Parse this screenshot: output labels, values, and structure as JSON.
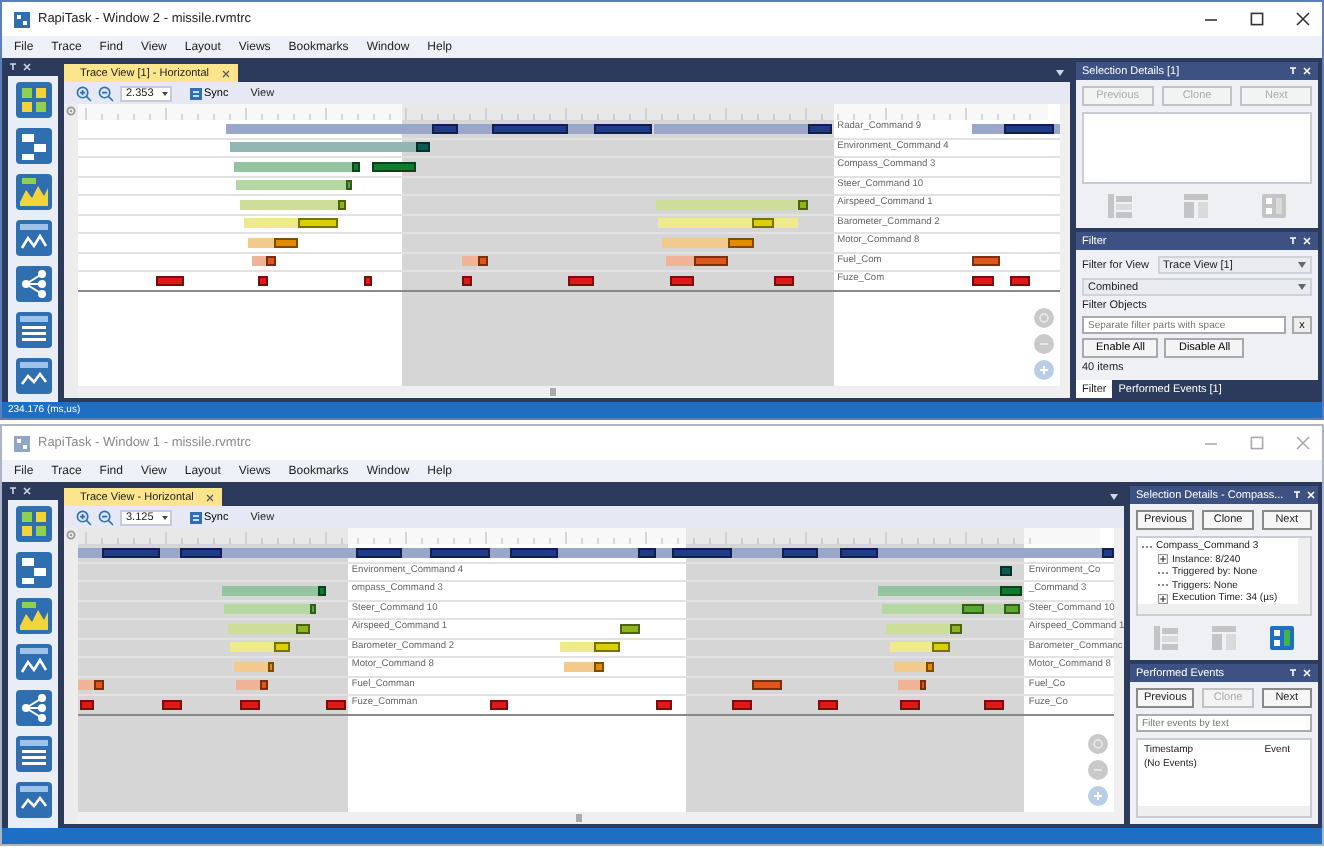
{
  "windows": [
    {
      "active": true,
      "title": "RapiTask - Window 2 - missile.rvmtrc",
      "menu": [
        "File",
        "Trace",
        "Find",
        "View",
        "Layout",
        "Views",
        "Bookmarks",
        "Window",
        "Help"
      ],
      "tab": "Trace View [1] - Horizontal",
      "zoom": "2.353",
      "sync": "Sync",
      "view": "View",
      "rows": [
        {
          "color": "#1f3a8a",
          "labels": [
            "Radar_Command 9"
          ]
        },
        {
          "color": "#0b5a4f",
          "labels": [
            "Environment_Command 4"
          ]
        },
        {
          "color": "#127a2e",
          "labels": [
            "Compass_Command 3"
          ]
        },
        {
          "color": "#5aa832",
          "labels": [
            "Steer_Command 10"
          ]
        },
        {
          "color": "#8fb51e",
          "labels": [
            "Airspeed_Command 1"
          ]
        },
        {
          "color": "#d8d000",
          "labels": [
            "Barometer_Command 2"
          ]
        },
        {
          "color": "#e38b00",
          "labels": [
            "Motor_Command 8"
          ]
        },
        {
          "color": "#e0561a",
          "labels": [
            "Fuel_Com"
          ]
        },
        {
          "color": "#e01818",
          "labels": [
            "Fuze_Com"
          ]
        }
      ],
      "panels": [
        {
          "kind": "details",
          "title": "Selection Details [1]",
          "buttons": [
            {
              "label": "Previous",
              "disabled": true
            },
            {
              "label": "Clone",
              "disabled": true
            },
            {
              "label": "Next",
              "disabled": true
            }
          ],
          "icons": [
            {
              "enabled": false
            },
            {
              "enabled": false
            },
            {
              "enabled": false
            }
          ]
        },
        {
          "kind": "filter",
          "title": "Filter",
          "view_label": "Filter for View",
          "view_value": "Trace View [1]",
          "mode": "Combined",
          "objects_label": "Filter Objects",
          "placeholder": "Separate filter parts with space",
          "clear": "x",
          "buttons": [
            "Enable All",
            "Disable All"
          ],
          "count": "40 items",
          "tabs": [
            {
              "label": "Filter",
              "selected": true
            },
            {
              "label": "Performed Events [1]",
              "selected": false
            }
          ]
        }
      ],
      "status": "234.176 (ms,us)"
    },
    {
      "active": false,
      "title": "RapiTask - Window 1 - missile.rvmtrc",
      "menu": [
        "File",
        "Trace",
        "Find",
        "View",
        "Layout",
        "Views",
        "Bookmarks",
        "Window",
        "Help"
      ],
      "tab": "Trace View - Horizontal",
      "zoom": "3.125",
      "sync": "Sync",
      "view": "View",
      "rows": [
        {
          "color": "#1f3a8a"
        },
        {
          "color": "#0b5a4f",
          "labels": [
            "Environment_Command 4",
            "Environment_Co"
          ]
        },
        {
          "color": "#127a2e",
          "labels": [
            "ompass_Command 3",
            "_Command 3"
          ]
        },
        {
          "color": "#5aa832",
          "labels": [
            "Steer_Command 10",
            "Steer_Command 10"
          ]
        },
        {
          "color": "#8fb51e",
          "labels": [
            "Airspeed_Command 1",
            "Airspeed_Command 1"
          ]
        },
        {
          "color": "#d8d000",
          "labels": [
            "Barometer_Command 2",
            "Barometer_Commanc"
          ]
        },
        {
          "color": "#e38b00",
          "labels": [
            "Motor_Command 8",
            "Motor_Command 8"
          ]
        },
        {
          "color": "#e0561a",
          "labels": [
            "Fuel_Comman",
            "Fuel_Co"
          ]
        },
        {
          "color": "#e01818",
          "labels": [
            "Fuze_Comman",
            "Fuze_Co"
          ]
        }
      ],
      "panels": [
        {
          "kind": "details",
          "title": "Selection Details - Compass...",
          "buttons": [
            {
              "label": "Previous",
              "disabled": false
            },
            {
              "label": "Clone",
              "disabled": false
            },
            {
              "label": "Next",
              "disabled": false
            }
          ],
          "tree": [
            {
              "label": "Compass_Command 3",
              "expandable": false,
              "children": [
                {
                  "label": "Instance: 8/240",
                  "expandable": true
                },
                {
                  "label": "Triggered by: None",
                  "expandable": false
                },
                {
                  "label": "Triggers: None",
                  "expandable": false
                },
                {
                  "label": "Execution Time: 34 (µs)",
                  "expandable": true
                }
              ]
            }
          ],
          "icons": [
            {
              "enabled": false
            },
            {
              "enabled": false
            },
            {
              "enabled": true
            }
          ]
        },
        {
          "kind": "events",
          "title": "Performed Events",
          "buttons": [
            {
              "label": "Previous",
              "disabled": false
            },
            {
              "label": "Clone",
              "disabled": true
            },
            {
              "label": "Next",
              "disabled": false
            }
          ],
          "placeholder": "Filter events by text",
          "columns": [
            "Timestamp",
            "Event"
          ],
          "empty": "(No Events)"
        }
      ]
    }
  ]
}
